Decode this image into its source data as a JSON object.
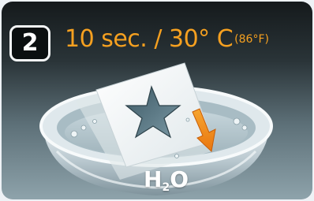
{
  "step": {
    "number": "2"
  },
  "header": {
    "duration_temp": "10 sec. / 30° C",
    "fahrenheit": "(86°F)"
  },
  "bowl": {
    "label_main": "H",
    "label_sub": "2",
    "label_end": "O"
  },
  "colors": {
    "accent": "#f5a020",
    "arrow": "#f08a1c",
    "badge_bg": "#0b0f10",
    "panel_top": "#151a1c",
    "panel_bottom": "#8ea3ab"
  },
  "icons": [
    "step-badge",
    "water-bowl-icon",
    "star-card-icon",
    "down-arrow-icon"
  ]
}
